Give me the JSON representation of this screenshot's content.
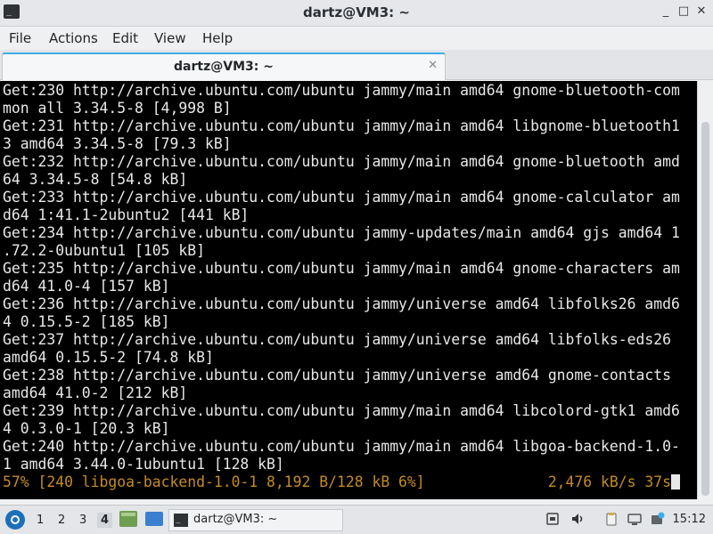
{
  "window": {
    "title": "dartz@VM3: ~",
    "app_icon": "terminal-icon",
    "app_icon_glyph": "_",
    "controls": {
      "minimize": "_",
      "maximize": "□",
      "close": "✕"
    }
  },
  "menubar": {
    "items": [
      {
        "label": "File"
      },
      {
        "label": "Actions"
      },
      {
        "label": "Edit"
      },
      {
        "label": "View"
      },
      {
        "label": "Help"
      }
    ]
  },
  "tabs": [
    {
      "label": "dartz@VM3: ~",
      "close": "✕"
    }
  ],
  "terminal": {
    "lines": [
      "Get:230 http://archive.ubuntu.com/ubuntu jammy/main amd64 gnome-bluetooth-com",
      "mon all 3.34.5-8 [4,998 B]",
      "Get:231 http://archive.ubuntu.com/ubuntu jammy/main amd64 libgnome-bluetooth1",
      "3 amd64 3.34.5-8 [79.3 kB]",
      "Get:232 http://archive.ubuntu.com/ubuntu jammy/main amd64 gnome-bluetooth amd",
      "64 3.34.5-8 [54.8 kB]",
      "Get:233 http://archive.ubuntu.com/ubuntu jammy/main amd64 gnome-calculator am",
      "d64 1:41.1-2ubuntu2 [441 kB]",
      "Get:234 http://archive.ubuntu.com/ubuntu jammy-updates/main amd64 gjs amd64 1",
      ".72.2-0ubuntu1 [105 kB]",
      "Get:235 http://archive.ubuntu.com/ubuntu jammy/main amd64 gnome-characters am",
      "d64 41.0-4 [157 kB]",
      "Get:236 http://archive.ubuntu.com/ubuntu jammy/universe amd64 libfolks26 amd6",
      "4 0.15.5-2 [185 kB]",
      "Get:237 http://archive.ubuntu.com/ubuntu jammy/universe amd64 libfolks-eds26",
      "amd64 0.15.5-2 [74.8 kB]",
      "Get:238 http://archive.ubuntu.com/ubuntu jammy/universe amd64 gnome-contacts",
      "amd64 41.0-2 [212 kB]",
      "Get:239 http://archive.ubuntu.com/ubuntu jammy/main amd64 libcolord-gtk1 amd6",
      "4 0.3.0-1 [20.3 kB]",
      "Get:240 http://archive.ubuntu.com/ubuntu jammy/main amd64 libgoa-backend-1.0-",
      "1 amd64 3.44.0-1ubuntu1 [128 kB]"
    ],
    "progress_line": "57% [240 libgoa-backend-1.0-1 8,192 B/128 kB 6%]              2,476 kB/s 37s",
    "text_color": "#e8e8e8",
    "progress_color": "#c48b26",
    "background": "#000000"
  },
  "taskbar": {
    "start_icon": "start-menu-icon",
    "workspaces": [
      "1",
      "2",
      "3",
      "4"
    ],
    "active_workspace": "4",
    "task": {
      "label": "dartz@VM3: ~",
      "icon": "terminal-icon",
      "glyph": "_"
    },
    "tray_icons": [
      "network-icon",
      "volume-icon",
      "clipboard-icon",
      "display-icon",
      "update-notifier-icon"
    ],
    "clock": "15:12"
  },
  "colors": {
    "accent": "#3daee9",
    "chrome": "#eff0f1"
  }
}
